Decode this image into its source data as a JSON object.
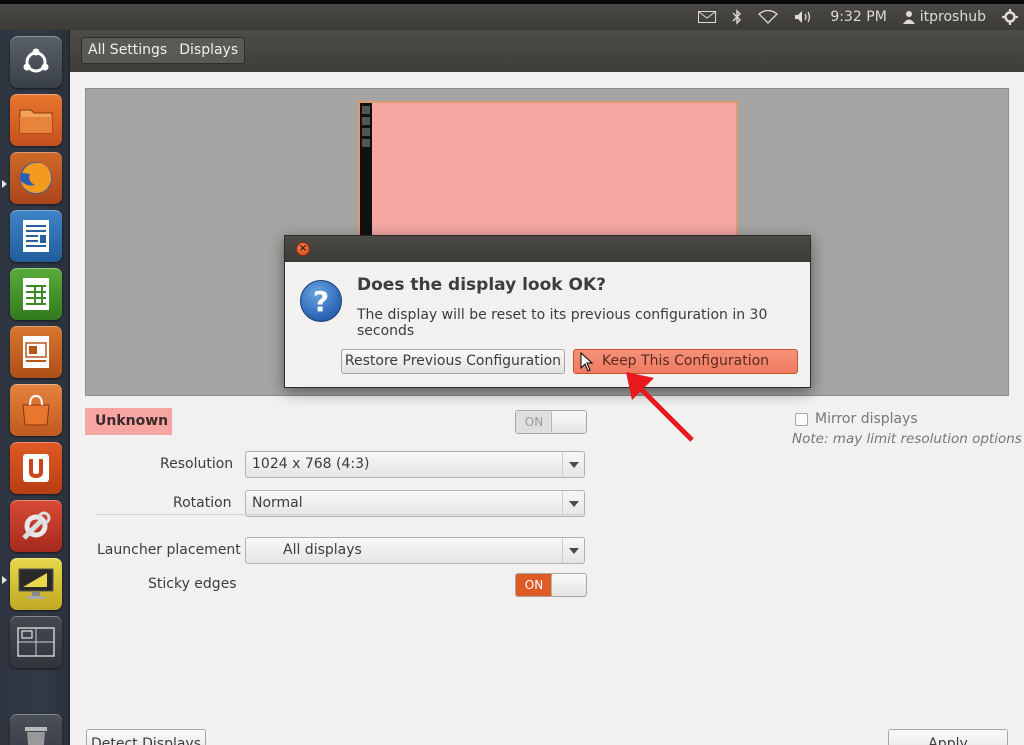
{
  "top_panel": {
    "time": "9:32 PM",
    "user": "itproshub",
    "icons": [
      "mail-icon",
      "bluetooth-icon",
      "wifi-icon",
      "volume-icon",
      "user-icon",
      "gear-icon"
    ]
  },
  "launcher": {
    "items": [
      "dash-home",
      "files",
      "firefox",
      "libreoffice-writer",
      "libreoffice-calc",
      "libreoffice-impress",
      "software-center",
      "ubuntu-one",
      "system-settings",
      "displays",
      "workspace-switcher",
      "trash"
    ]
  },
  "breadcrumb": {
    "all_settings": "All Settings",
    "displays": "Displays"
  },
  "display": {
    "name": "Unknown",
    "power_state": "ON",
    "mirror_label": "Mirror displays",
    "mirror_note": "Note: may limit resolution options",
    "resolution_label": "Resolution",
    "resolution_value": "1024 x 768 (4:3)",
    "rotation_label": "Rotation",
    "rotation_value": "Normal",
    "launcher_placement_label": "Launcher placement",
    "launcher_placement_value": "All displays",
    "sticky_edges_label": "Sticky edges",
    "sticky_edges_state": "ON",
    "detect_button": "Detect Displays",
    "apply_button": "Apply"
  },
  "dialog": {
    "title": "Does the display look OK?",
    "message": "The display will be reset to its previous configuration in 30 seconds",
    "restore_button": "Restore Previous Configuration",
    "keep_button": "Keep This Configuration"
  },
  "colors": {
    "accent": "#e05a25",
    "monitor_fill": "#f4a7a3",
    "annotation_arrow": "#e8191d"
  }
}
